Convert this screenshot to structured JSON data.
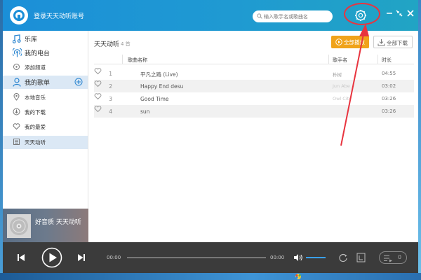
{
  "app": {
    "login_label": "登录天天动听账号",
    "search_placeholder": "输入歌手名或歌曲名"
  },
  "sidebar": {
    "items": [
      {
        "label": "乐库",
        "icon": "music-note-icon"
      },
      {
        "label": "我的电台",
        "icon": "radio-icon"
      },
      {
        "label": "添加频道",
        "icon": "add-channel-icon"
      },
      {
        "label": "我的歌单",
        "icon": "user-icon"
      },
      {
        "label": "本地音乐",
        "icon": "location-icon"
      },
      {
        "label": "我的下载",
        "icon": "download-icon"
      },
      {
        "label": "我的最爱",
        "icon": "heart-icon"
      },
      {
        "label": "天天动听",
        "icon": "list-icon"
      }
    ]
  },
  "album": {
    "text": "好音质 天天动听"
  },
  "playlist": {
    "title": "天天动听",
    "count": "4 首",
    "play_all_label": "全部播放",
    "download_all_label": "全部下载",
    "columns": {
      "name": "歌曲名称",
      "artist": "歌手名",
      "duration": "时长"
    },
    "songs": [
      {
        "num": "1",
        "name": "平凡之路 (Live)",
        "artist": "朴树",
        "duration": "04:55"
      },
      {
        "num": "2",
        "name": "Happy End desu",
        "artist": "Jun Abe",
        "duration": "03:02"
      },
      {
        "num": "3",
        "name": "Good Time",
        "artist": "Owl City",
        "duration": "03:26"
      },
      {
        "num": "4",
        "name": "sun",
        "artist": "",
        "duration": "03:26"
      }
    ]
  },
  "player": {
    "current_time": "00:00",
    "total_time": "00:00",
    "queue_count": "0"
  },
  "colors": {
    "titlebar": "#1b8fd8",
    "accent_orange": "#f0a31a",
    "annotation_red": "#e8343f",
    "player_bg": "#3b3b3b"
  }
}
